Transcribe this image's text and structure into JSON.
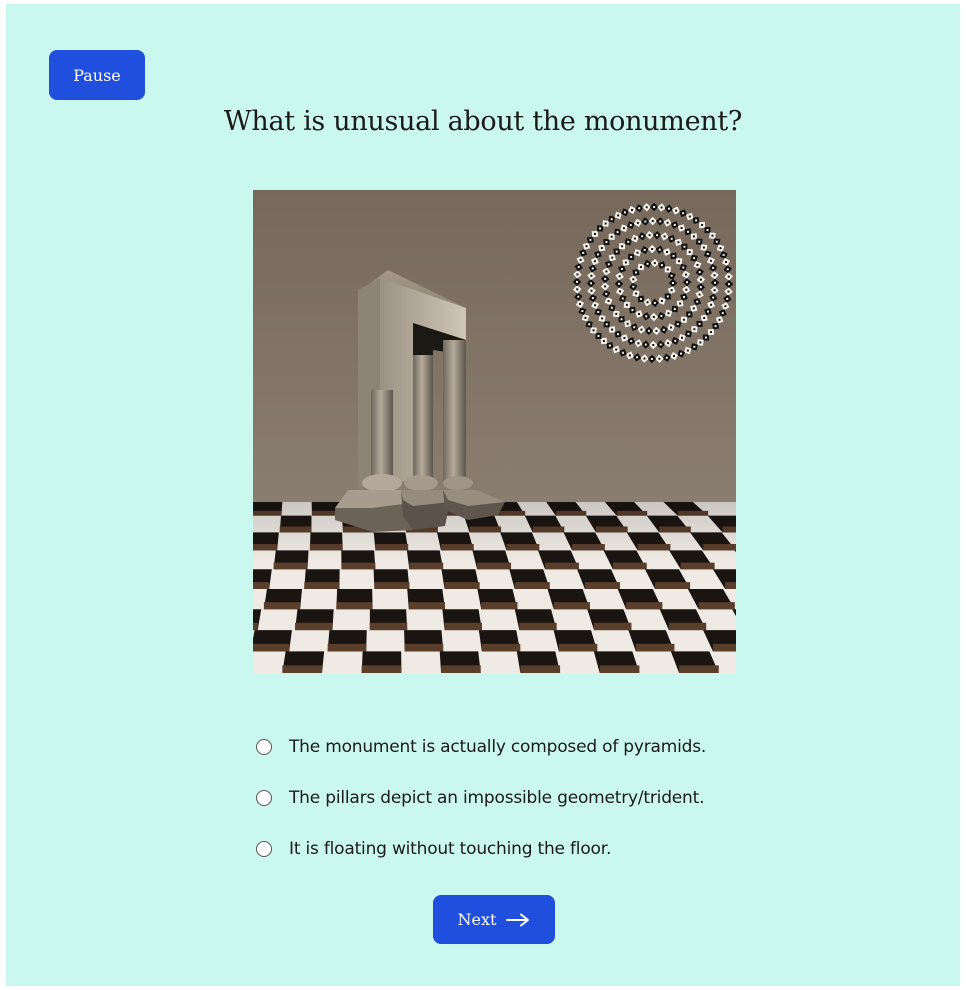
{
  "controls": {
    "pause_label": "Pause",
    "next_label": "Next",
    "next_icon": "arrow-right-icon"
  },
  "question": {
    "text": "What is unusual about the monument?"
  },
  "image": {
    "subject": "illusion-monument-with-three-pillars-on-checkered-floor"
  },
  "options": [
    {
      "label": "The monument is actually composed of pyramids.",
      "selected": false
    },
    {
      "label": "The pillars depict an impossible geometry/trident.",
      "selected": false
    },
    {
      "label": "It is floating without touching the floor.",
      "selected": false
    }
  ],
  "colors": {
    "background": "#cbf8ee",
    "button": "#1f4fdc",
    "button_text": "#ffffff"
  }
}
